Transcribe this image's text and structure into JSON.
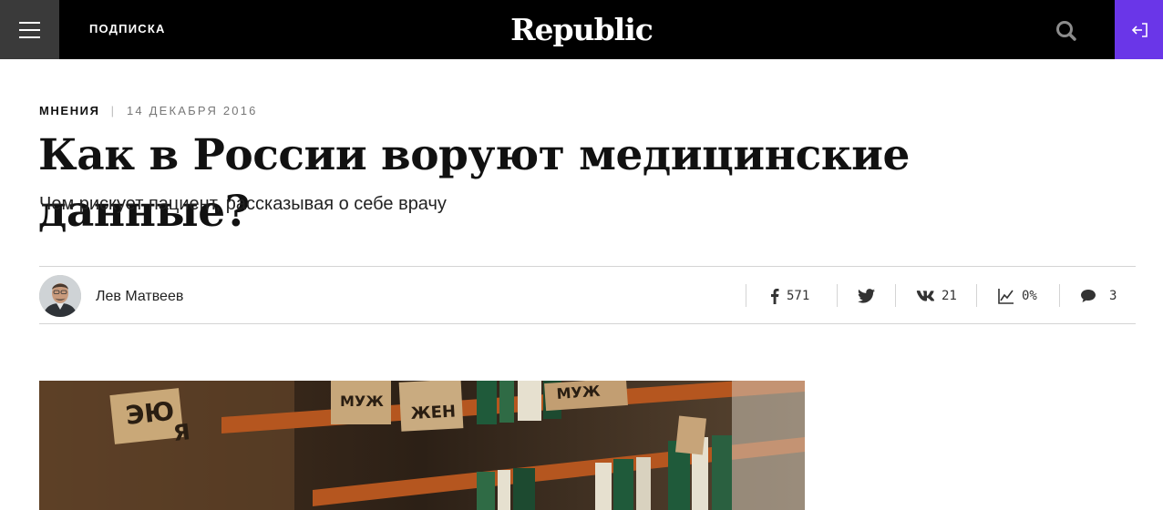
{
  "header": {
    "subscribe_label": "ПОДПИСКА",
    "logo_text": "Republic",
    "login_color": "#6a36e8"
  },
  "article": {
    "rubric": "МНЕНИЯ",
    "separator": "|",
    "date": "14 ДЕКАБРЯ 2016",
    "title": "Как в России воруют медицинские данные?",
    "subtitle": "Чем рискует пациент, рассказывая о себе врачу"
  },
  "author": {
    "name": "Лев Матвеев",
    "avatar_icon": "author-photo"
  },
  "share": {
    "facebook_count": "571",
    "vk_count": "21",
    "read_percent": "0%",
    "comments_count": "3"
  },
  "hero": {
    "labels": [
      "ЭЮ",
      "Я",
      "МУЖ",
      "ЖЕН",
      "МУЖ"
    ]
  }
}
